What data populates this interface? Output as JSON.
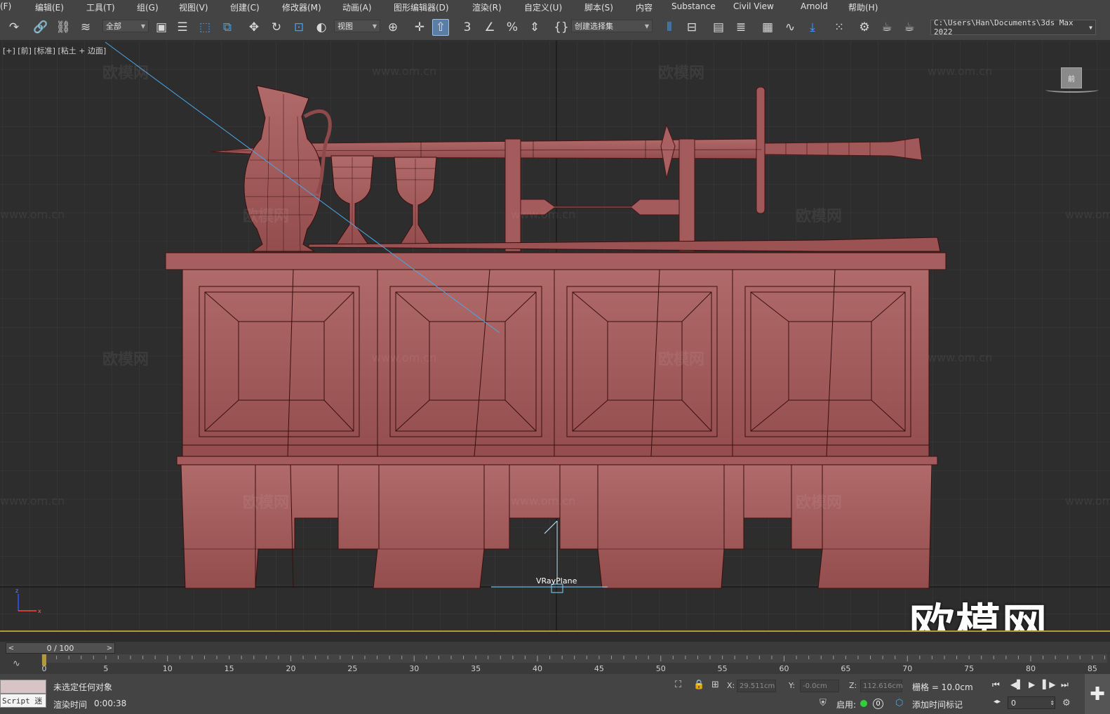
{
  "menu": [
    {
      "key": "file",
      "label": "(F)"
    },
    {
      "key": "edit",
      "label": "编辑(E)"
    },
    {
      "key": "tools",
      "label": "工具(T)"
    },
    {
      "key": "group",
      "label": "组(G)"
    },
    {
      "key": "view",
      "label": "视图(V)"
    },
    {
      "key": "create",
      "label": "创建(C)"
    },
    {
      "key": "modifiers",
      "label": "修改器(M)"
    },
    {
      "key": "animation",
      "label": "动画(A)"
    },
    {
      "key": "graph-editors",
      "label": "图形编辑器(D)"
    },
    {
      "key": "rendering",
      "label": "渲染(R)"
    },
    {
      "key": "customize",
      "label": "自定义(U)"
    },
    {
      "key": "scripting",
      "label": "脚本(S)"
    },
    {
      "key": "content",
      "label": "内容"
    },
    {
      "key": "substance",
      "label": "Substance"
    },
    {
      "key": "civil-view",
      "label": "Civil View"
    },
    {
      "key": "arnold",
      "label": "Arnold"
    },
    {
      "key": "help",
      "label": "帮助(H)"
    }
  ],
  "toolbar": {
    "filter_value": "全部",
    "refcoord_value": "视图",
    "selection_set_value": "创建选择集",
    "path_value": "C:\\Users\\Han\\Documents\\3ds Max 2022",
    "snap_label": "3",
    "icons": [
      "redo-icon",
      "link-icon",
      "unlink-icon",
      "bind-spacewarp-icon",
      "select-object-icon",
      "select-by-name-icon",
      "rect-region-icon",
      "window-crossing-icon",
      "move-icon",
      "rotate-icon",
      "scale-icon",
      "placement-icon",
      "use-pivot-icon",
      "select-manipulate-icon",
      "keyboard-shortcut-icon",
      "snap-icon",
      "angle-snap-icon",
      "percent-snap-icon",
      "spinner-snap-icon",
      "edit-named-sets-icon",
      "mirror-icon",
      "align-icon",
      "scene-explorer-icon",
      "layer-explorer-icon",
      "ribbon-icon",
      "curve-editor-icon",
      "schematic-view-icon",
      "material-editor-icon",
      "render-setup-icon",
      "rendered-frame-icon",
      "render-icon"
    ]
  },
  "viewport": {
    "label": "[+] [前] [标准] [粘土 + 边面]",
    "watermark_text": "欧模网",
    "watermark_url": "www.om.cn",
    "logo_text": "欧模网",
    "vray_label": "VRayPlane",
    "viewcube_label": "前",
    "mesh_color": "#a85e5e",
    "wire_color": "#3d0f0f"
  },
  "timeline": {
    "slider_value": "0 / 100",
    "ticks": [
      0,
      5,
      10,
      15,
      20,
      25,
      30,
      35,
      40,
      45,
      50,
      55,
      60,
      65,
      70,
      75,
      80,
      85
    ]
  },
  "status": {
    "script_text": "Script 迷",
    "message": "未选定任何对象",
    "render_time_label": "渲染时间",
    "render_time_value": "0:00:38",
    "x_label": "X:",
    "x_value": "29.511cm",
    "y_label": "Y:",
    "y_value": "-0.0cm",
    "z_label": "Z:",
    "z_value": "112.616cm",
    "grid_text": "栅格 = 10.0cm",
    "enable_label": "启用:",
    "zero_badge": "0",
    "add_time_tag": "添加时间标记",
    "frame_value": "0",
    "accent_green": "#2fd13a",
    "accent_gold": "#b39a39"
  }
}
